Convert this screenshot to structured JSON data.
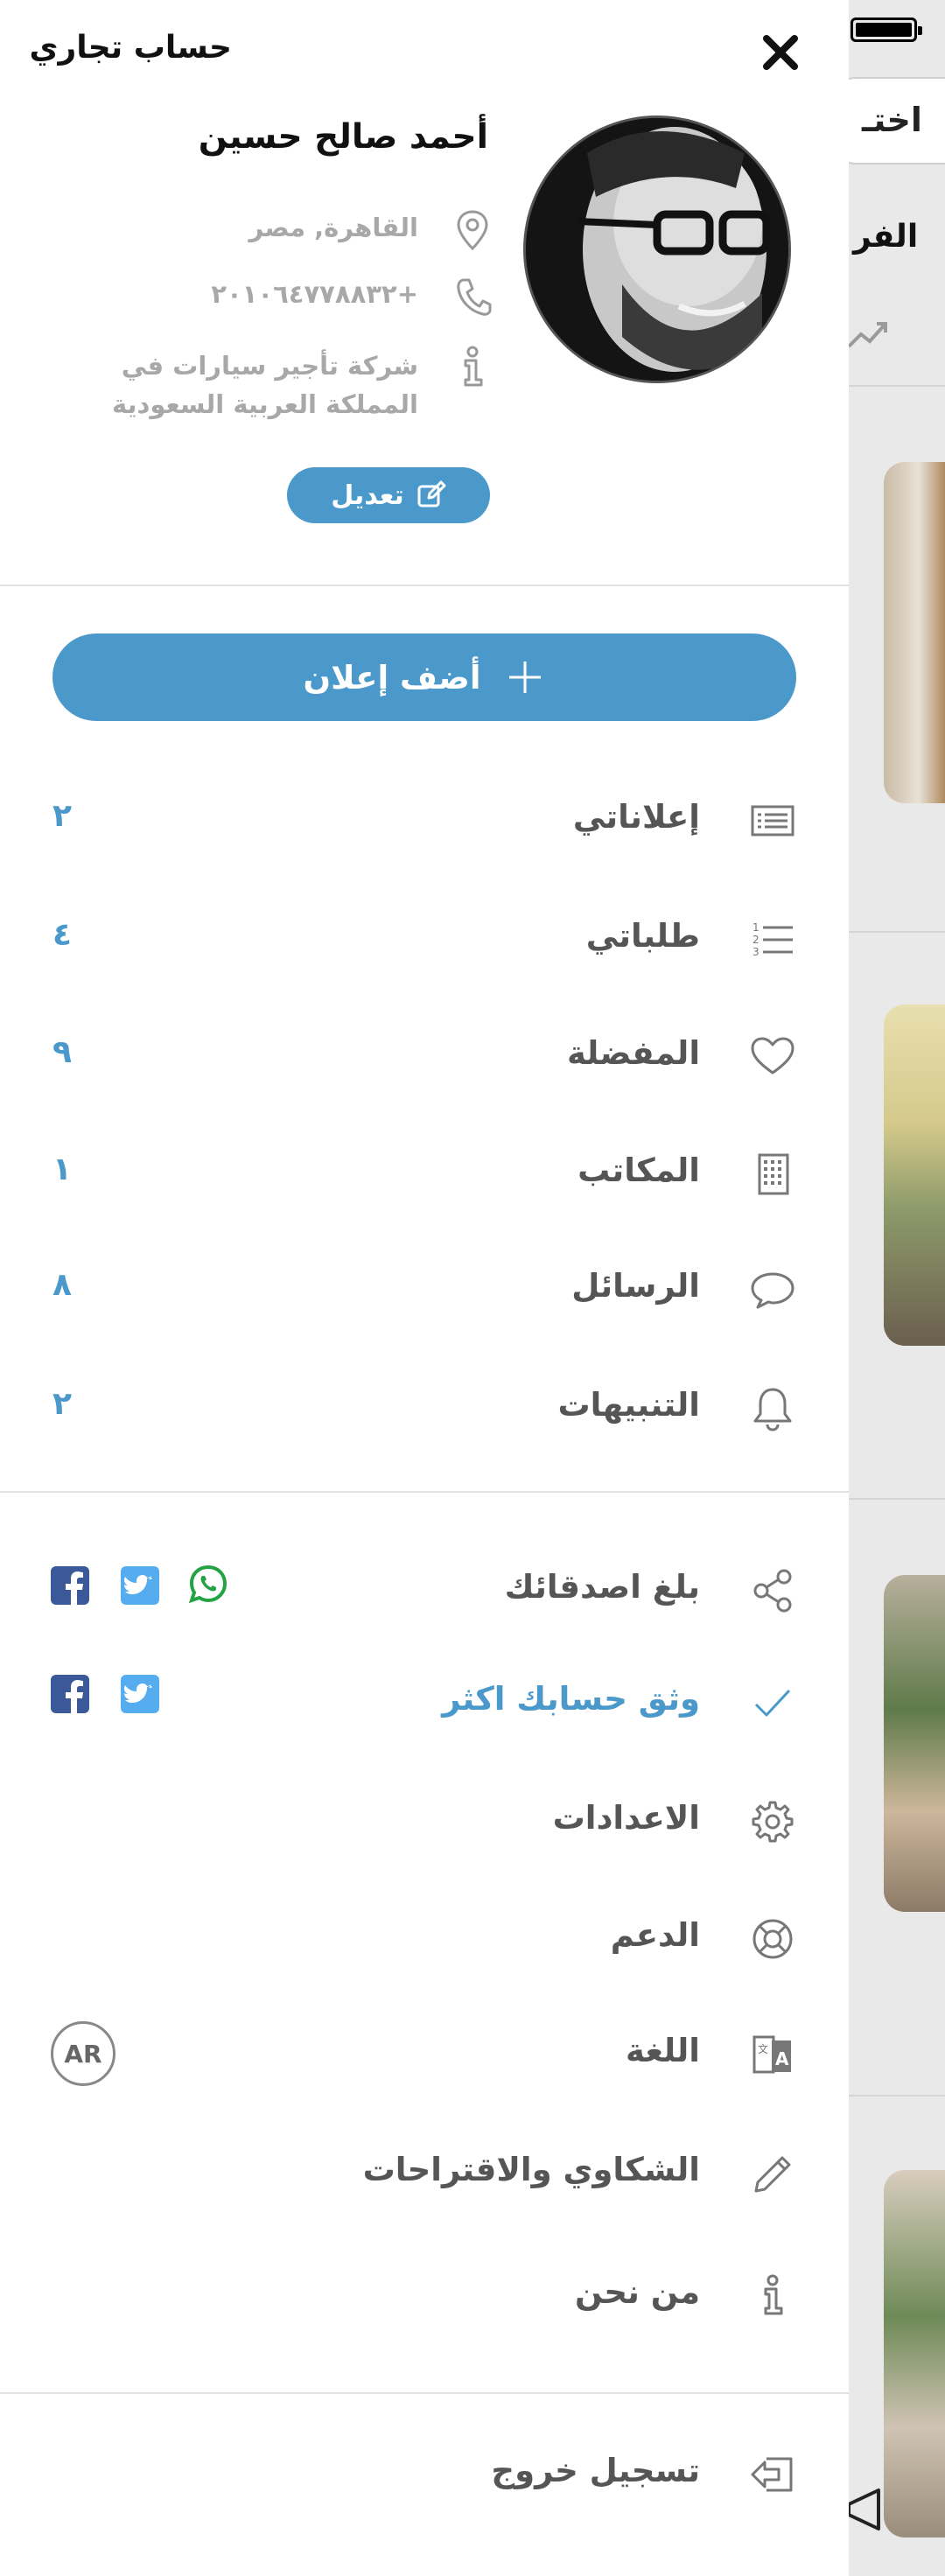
{
  "header": {
    "account_type": "حساب تجاري"
  },
  "profile": {
    "name": "أحمد صالح حسين",
    "location": "القاهرة, مصر",
    "phone": "+٢٠١٠٦٤٧٧٨٨٣٢",
    "company": "شركة تأجير سيارات في المملكة العربية السعودية",
    "edit_label": "تعديل"
  },
  "add_ad_label": "أضف إعلان",
  "menu": [
    {
      "label": "إعلاناتي",
      "count": "٢",
      "icon": "list-icon"
    },
    {
      "label": "طلباتي",
      "count": "٤",
      "icon": "numbered-list-icon"
    },
    {
      "label": "المفضلة",
      "count": "٩",
      "icon": "heart-icon"
    },
    {
      "label": "المكاتب",
      "count": "١",
      "icon": "building-icon"
    },
    {
      "label": "الرسائل",
      "count": "٨",
      "icon": "chat-bubble-icon"
    },
    {
      "label": "التنبيهات",
      "count": "٢",
      "icon": "bell-icon"
    }
  ],
  "secondary_menu": {
    "share": {
      "label": "بلغ اصدقائك",
      "icon": "share-icon"
    },
    "verify": {
      "label": "وثق حسابك اكثر",
      "icon": "check-icon"
    },
    "settings": {
      "label": "الاعدادات",
      "icon": "gear-icon"
    },
    "support": {
      "label": "الدعم",
      "icon": "lifebuoy-icon"
    },
    "language": {
      "label": "اللغة",
      "icon": "translate-icon",
      "badge": "AR"
    },
    "complaints": {
      "label": "الشكاوي والاقتراحات",
      "icon": "pencil-icon"
    },
    "about": {
      "label": "من نحن",
      "icon": "info-icon"
    },
    "logout": {
      "label": "تسجيل خروج",
      "icon": "logout-icon"
    }
  },
  "background_app": {
    "pill_text": "اختـ",
    "tab_text": "الفر"
  },
  "colors": {
    "accent": "#4b99ca",
    "facebook": "#3b5998",
    "twitter": "#55acee",
    "whatsapp": "#25a244"
  }
}
